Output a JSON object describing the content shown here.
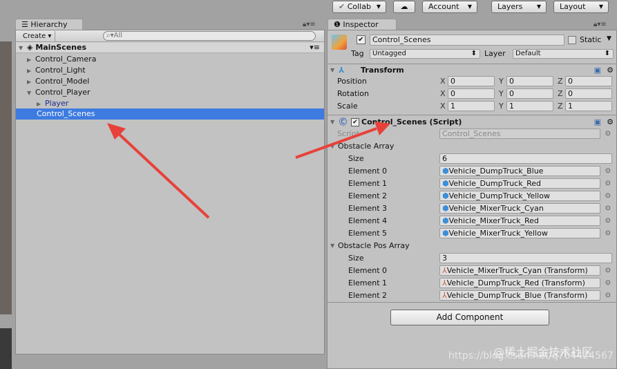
{
  "toolbar": {
    "collab": "Collab",
    "cloud_icon": "cloud-icon",
    "account": "Account",
    "layers": "Layers",
    "layout": "Layout"
  },
  "hierarchy": {
    "tab": "Hierarchy",
    "create": "Create",
    "search_placeholder": "All",
    "scene": "MainScenes",
    "items": [
      {
        "label": "Control_Camera",
        "state": "collapsed"
      },
      {
        "label": "Control_Light",
        "state": "collapsed"
      },
      {
        "label": "Control_Model",
        "state": "collapsed"
      },
      {
        "label": "Control_Player",
        "state": "expanded"
      },
      {
        "label": "Player",
        "state": "collapsed",
        "prefab": true
      },
      {
        "label": "Control_Scenes",
        "selected": true
      }
    ]
  },
  "inspector": {
    "tab": "Inspector",
    "object_name": "Control_Scenes",
    "static_label": "Static",
    "tag_label": "Tag",
    "tag_value": "Untagged",
    "layer_label": "Layer",
    "layer_value": "Default",
    "transform": {
      "title": "Transform",
      "rows": [
        {
          "label": "Position",
          "x": "0",
          "y": "0",
          "z": "0"
        },
        {
          "label": "Rotation",
          "x": "0",
          "y": "0",
          "z": "0"
        },
        {
          "label": "Scale",
          "x": "1",
          "y": "1",
          "z": "1"
        }
      ]
    },
    "script": {
      "title": "Control_Scenes (Script)",
      "script_label": "Script",
      "script_value": "Control_Scenes",
      "obstacle_array": {
        "label": "Obstacle Array",
        "size_label": "Size",
        "size": "6",
        "elements": [
          {
            "label": "Element 0",
            "value": "Vehicle_DumpTruck_Blue"
          },
          {
            "label": "Element 1",
            "value": "Vehicle_DumpTruck_Red"
          },
          {
            "label": "Element 2",
            "value": "Vehicle_DumpTruck_Yellow"
          },
          {
            "label": "Element 3",
            "value": "Vehicle_MixerTruck_Cyan"
          },
          {
            "label": "Element 4",
            "value": "Vehicle_MixerTruck_Red"
          },
          {
            "label": "Element 5",
            "value": "Vehicle_MixerTruck_Yellow"
          }
        ]
      },
      "obstacle_pos_array": {
        "label": "Obstacle Pos Array",
        "size_label": "Size",
        "size": "3",
        "elements": [
          {
            "label": "Element 0",
            "value": "Vehicle_MixerTruck_Cyan (Transform)"
          },
          {
            "label": "Element 1",
            "value": "Vehicle_DumpTruck_Red (Transform)"
          },
          {
            "label": "Element 2",
            "value": "Vehicle_DumpTruck_Blue (Transform)"
          }
        ]
      }
    },
    "add_component": "Add Component"
  },
  "watermark": {
    "line1": "@稀土掘金技术社区",
    "line2": "https://blog.csdn.net/q764424567"
  },
  "colors": {
    "selection": "#3d7be0",
    "arrow": "#e8413a",
    "prefab_text": "#1f2a8c"
  }
}
